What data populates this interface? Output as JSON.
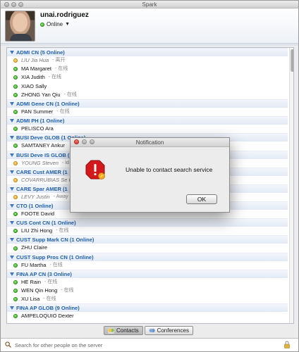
{
  "window": {
    "title": "Spark"
  },
  "profile": {
    "username": "unai.rodriguez",
    "presence": "Online"
  },
  "roster": [
    {
      "group": "ADMI CN (5 Online)",
      "contacts": [
        {
          "name": "LIU Jia Hua",
          "status": "- 离开",
          "away": true
        },
        {
          "name": "MA Margaret",
          "status": "- 在线"
        },
        {
          "name": "XIA Judith",
          "status": "- 在线"
        },
        {
          "name": "XIAO Sally",
          "status": ""
        },
        {
          "name": "ZHONG Yan Qiu",
          "status": "- 在线"
        }
      ]
    },
    {
      "group": "ADMI Gene CN (1 Online)",
      "contacts": [
        {
          "name": "PAN Summer",
          "status": "- 在线"
        }
      ]
    },
    {
      "group": "ADMI PH (1 Online)",
      "contacts": [
        {
          "name": "PELISCO Ara",
          "status": ""
        }
      ]
    },
    {
      "group": "BUSI Deve GLOB (1 Online)",
      "contacts": [
        {
          "name": "SAMTANEY Ankur",
          "status": ""
        }
      ]
    },
    {
      "group": "BUSI Deve IS GLOB (",
      "contacts": [
        {
          "name": "YOUNG Steven",
          "status": "- Id",
          "away": true
        }
      ]
    },
    {
      "group": "CARE Cust AMER (1",
      "contacts": [
        {
          "name": "COVARRUBIAS Se R",
          "status": "",
          "away": true
        }
      ]
    },
    {
      "group": "CARE Spar AMER (1",
      "contacts": [
        {
          "name": "LEVY Justin",
          "status": "- Away",
          "away": true
        }
      ]
    },
    {
      "group": "CTO (1 Online)",
      "contacts": [
        {
          "name": "FOOTE David",
          "status": ""
        }
      ]
    },
    {
      "group": "CUS Cont CN (1 Online)",
      "contacts": [
        {
          "name": "LIU Zhi Hong",
          "status": "- 在线"
        }
      ]
    },
    {
      "group": "CUST Supp Mark CN (1 Online)",
      "contacts": [
        {
          "name": "ZHU Claire",
          "status": ""
        }
      ]
    },
    {
      "group": "CUST Supp Pros CN (1 Online)",
      "contacts": [
        {
          "name": "FU Martha",
          "status": "- 在线"
        }
      ]
    },
    {
      "group": "FINA AP CN (3 Online)",
      "contacts": [
        {
          "name": "HE Rain",
          "status": "- 在线"
        },
        {
          "name": "WEN Qin Hong",
          "status": "- 在线"
        },
        {
          "name": "XU Lisa",
          "status": "- 在线"
        }
      ]
    },
    {
      "group": "FINA AP GLOB (9 Online)",
      "contacts": [
        {
          "name": "AMPELOQUIO Dexter",
          "status": ""
        }
      ]
    }
  ],
  "tabs": {
    "contacts": "Contacts",
    "conferences": "Conferences"
  },
  "search": {
    "placeholder": "Search for other people on the server"
  },
  "dialog": {
    "title": "Notification",
    "message": "Unable to contact search service",
    "ok": "OK"
  },
  "colors": {
    "group_text": "#1f5fae",
    "online": "#2aa51b",
    "away": "#e2a11b",
    "alert_red": "#d3191c"
  }
}
